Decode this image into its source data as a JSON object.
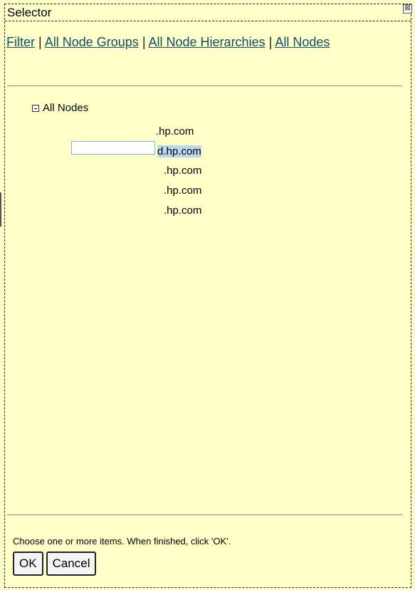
{
  "dialog": {
    "title": "Selector",
    "close_glyph": "⊠"
  },
  "links": [
    {
      "label": "Filter"
    },
    {
      "label": "All Node Groups"
    },
    {
      "label": "All Node Hierarchies"
    },
    {
      "label": "All Nodes"
    }
  ],
  "separator": "|",
  "tree": {
    "root_label": "All Nodes",
    "nodes": [
      {
        "text": ".hp.com",
        "selected": false
      },
      {
        "text": "d.hp.com",
        "selected": true
      },
      {
        "text": ".hp.com",
        "selected": false
      },
      {
        "text": ".hp.com",
        "selected": false
      },
      {
        "text": ".hp.com",
        "selected": false
      }
    ]
  },
  "footer": {
    "instructions": "Choose one or more items. When finished, click 'OK'.",
    "ok_label": "OK",
    "cancel_label": "Cancel"
  },
  "colors": {
    "background": "#ffffc8",
    "link": "#0b4f6c",
    "selection": "#b9d9f0"
  }
}
